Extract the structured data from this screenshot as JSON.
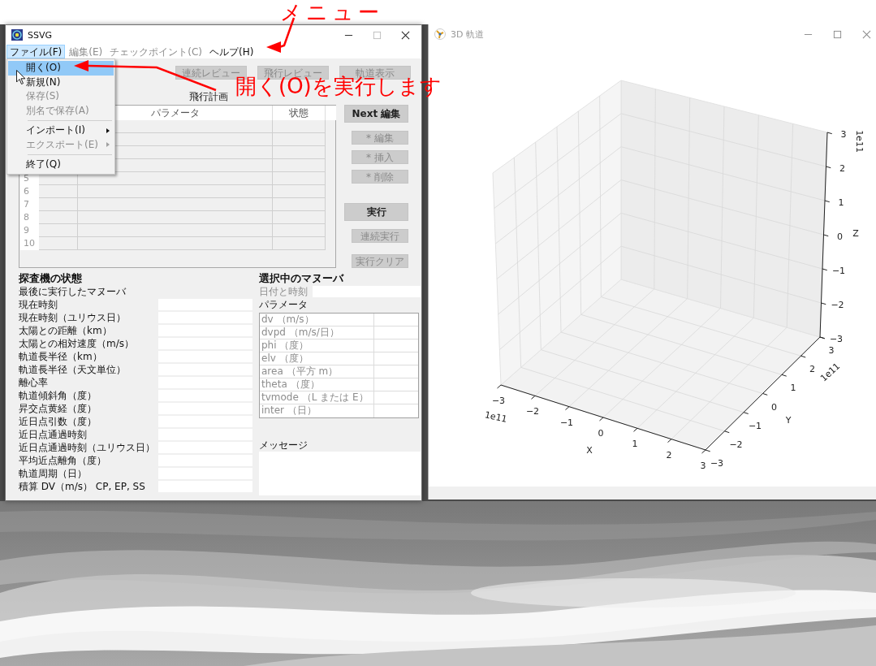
{
  "left_window": {
    "title": "SSVG",
    "active": true,
    "menubar": [
      {
        "label": "ファイル(F)",
        "selected": true,
        "disabled": false
      },
      {
        "label": "編集(E)",
        "selected": false,
        "disabled": true
      },
      {
        "label": "チェックポイント(C)",
        "selected": false,
        "disabled": true
      },
      {
        "label": "ヘルプ(H)",
        "selected": false,
        "disabled": false
      }
    ],
    "file_menu": [
      {
        "kind": "item",
        "label": "開く(O)",
        "selected": true,
        "disabled": false
      },
      {
        "kind": "item",
        "label": "新規(N)",
        "selected": false,
        "disabled": false
      },
      {
        "kind": "item",
        "label": "保存(S)",
        "selected": false,
        "disabled": true
      },
      {
        "kind": "item",
        "label": "別名で保存(A)",
        "selected": false,
        "disabled": true
      },
      {
        "kind": "separator"
      },
      {
        "kind": "submenu",
        "label": "インポート(I)",
        "selected": false,
        "disabled": false
      },
      {
        "kind": "submenu",
        "label": "エクスポート(E)",
        "selected": false,
        "disabled": true
      },
      {
        "kind": "separator"
      },
      {
        "kind": "item",
        "label": "終了(Q)",
        "selected": false,
        "disabled": false
      }
    ],
    "review_buttons": [
      {
        "label": "連続レビュー",
        "disabled": true
      },
      {
        "label": "飛行レビュー",
        "disabled": true
      },
      {
        "label": "軌道表示",
        "disabled": true
      }
    ],
    "plan_title": "飛行計画",
    "plan_table": {
      "columns": [
        "パラメータ",
        "状態"
      ],
      "row_numbers": [
        "5",
        "6",
        "7",
        "8",
        "9",
        "10"
      ]
    },
    "side_buttons": [
      {
        "kind": "large",
        "label": "Next 編集",
        "disabled": false
      },
      {
        "kind": "small",
        "label": "* 編集",
        "disabled": true
      },
      {
        "kind": "small",
        "label": "* 挿入",
        "disabled": true
      },
      {
        "kind": "small",
        "label": "* 削除",
        "disabled": true
      },
      {
        "kind": "large",
        "label": "実行",
        "disabled": false
      },
      {
        "kind": "small",
        "label": "連続実行",
        "disabled": true
      },
      {
        "kind": "small",
        "label": "実行クリア",
        "disabled": true
      }
    ],
    "probe_state": {
      "title": "探査機の状態",
      "rows": [
        {
          "label": "最後に実行したマヌーバ",
          "field": false
        },
        {
          "label": "現在時刻",
          "field": true
        },
        {
          "label": "現在時刻（ユリウス日）",
          "field": true
        },
        {
          "label": "太陽との距離（km）",
          "field": true
        },
        {
          "label": "太陽との相対速度（m/s）",
          "field": true
        },
        {
          "label": "軌道長半径（km）",
          "field": true
        },
        {
          "label": "軌道長半径（天文単位）",
          "field": true
        },
        {
          "label": "離心率",
          "field": true
        },
        {
          "label": "軌道傾斜角（度）",
          "field": true
        },
        {
          "label": "昇交点黄経（度）",
          "field": true
        },
        {
          "label": "近日点引数（度）",
          "field": true
        },
        {
          "label": "近日点通過時刻",
          "field": true
        },
        {
          "label": "近日点通過時刻（ユリウス日）",
          "field": true
        },
        {
          "label": "平均近点離角（度）",
          "field": true
        },
        {
          "label": "軌道周期（日）",
          "field": true
        },
        {
          "label": "積算 DV（m/s） CP, EP, SS",
          "field": true
        }
      ]
    },
    "selected_maneuver": {
      "title": "選択中のマヌーバ",
      "date_time": {
        "label": "日付と時刻",
        "disabled": true
      },
      "parameters_label": "パラメータ",
      "parameters": {
        "disabled": true,
        "rows": [
          "dv （m/s）",
          "dvpd （m/s/日）",
          "phi （度）",
          "elv （度）",
          "area （平方 m）",
          "theta （度）",
          "tvmode （L または E）",
          "inter （日）"
        ]
      }
    },
    "message": {
      "label": "メッセージ"
    }
  },
  "orbit_window": {
    "title": "3D 軌道",
    "active": false,
    "plot": {
      "x_label": "X",
      "y_label": "Y",
      "z_label": "Z",
      "x_ticks": [
        "−3",
        "−2",
        "−1",
        "0",
        "1",
        "2",
        "3"
      ],
      "y_ticks": [
        "−3",
        "−2",
        "−1",
        "0",
        "1",
        "2",
        "3"
      ],
      "z_ticks": [
        "3",
        "2",
        "1",
        "0",
        "−1",
        "−2",
        "−3"
      ],
      "x_offset": "1e11",
      "y_offset": "1e11",
      "z_offset": "1e11"
    }
  },
  "annotations": [
    {
      "text": "メニュー"
    },
    {
      "text": "開く(O)を実行します"
    }
  ]
}
